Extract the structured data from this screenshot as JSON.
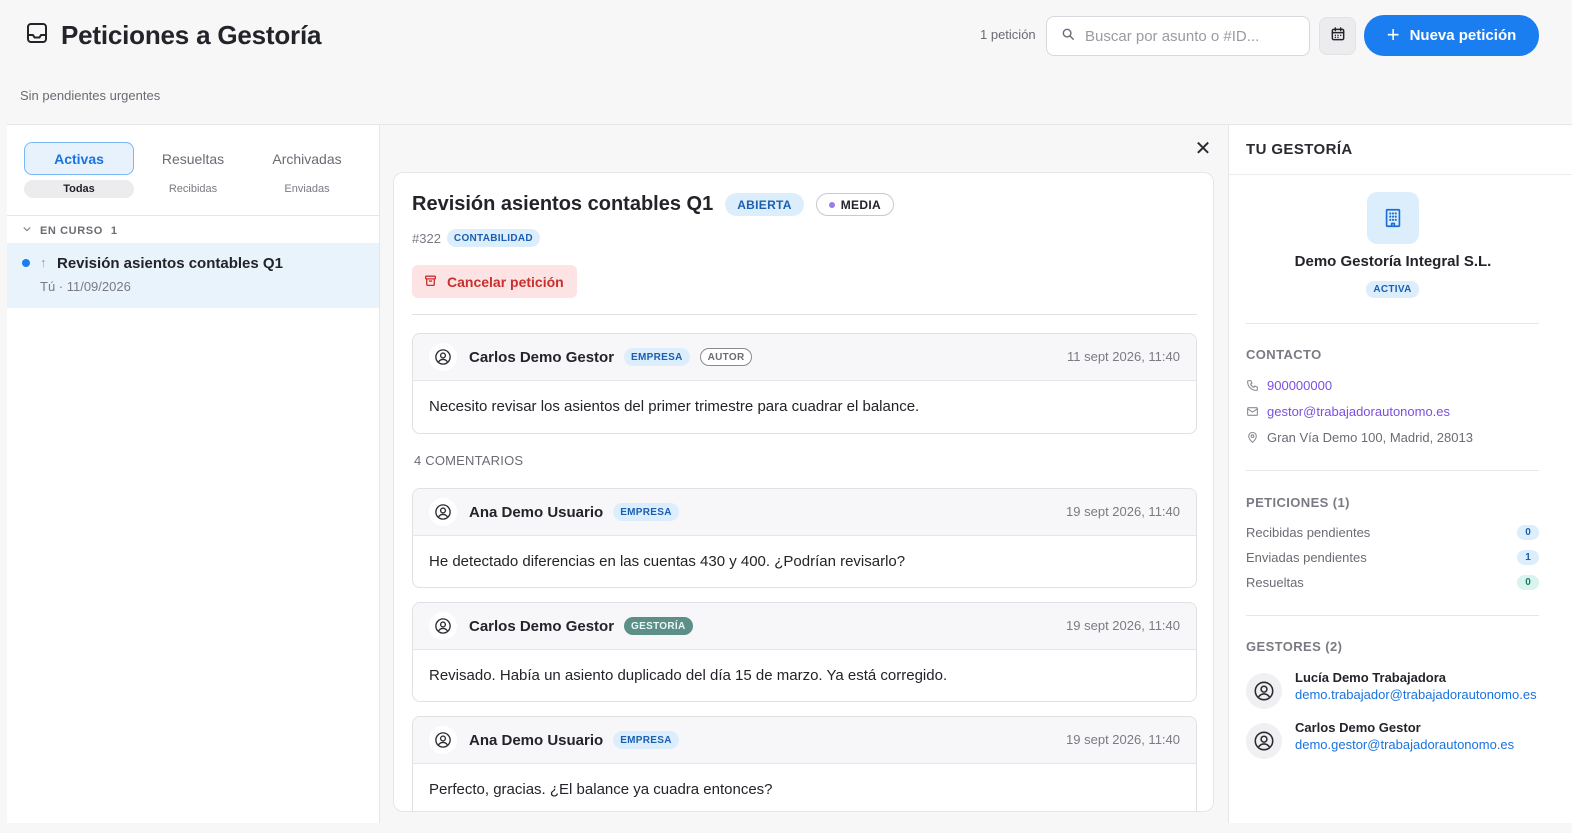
{
  "header": {
    "title": "Peticiones a Gestoría",
    "subtitle": "Sin pendientes urgentes",
    "count_label": "1 petición",
    "search_placeholder": "Buscar por asunto o #ID...",
    "new_button_label": "Nueva petición",
    "accent_color": "#1a7df0"
  },
  "left": {
    "tabs": [
      "Activas",
      "Resueltas",
      "Archivadas"
    ],
    "subtabs": [
      "Todas",
      "Recibidas",
      "Enviadas"
    ],
    "group_label": "EN CURSO",
    "group_count": "1",
    "items": [
      {
        "title": "Revisión asientos contables Q1",
        "meta": "Tú · 11/09/2026"
      }
    ]
  },
  "detail": {
    "title": "Revisión asientos contables Q1",
    "status": "ABIERTA",
    "priority": "MEDIA",
    "id": "#322",
    "category": "CONTABILIDAD",
    "cancel_label": "Cancelar petición",
    "original": {
      "author": "Carlos Demo Gestor",
      "tags": [
        "EMPRESA",
        "AUTOR"
      ],
      "date": "11 sept 2026, 11:40",
      "body": "Necesito revisar los asientos del primer trimestre para cuadrar el balance."
    },
    "comments_label": "4 COMENTARIOS",
    "comments": [
      {
        "author": "Ana Demo Usuario",
        "tag": "EMPRESA",
        "date": "19 sept 2026, 11:40",
        "body": "He detectado diferencias en las cuentas 430 y 400. ¿Podrían revisarlo?"
      },
      {
        "author": "Carlos Demo Gestor",
        "tag": "GESTORÍA",
        "date": "19 sept 2026, 11:40",
        "body": "Revisado. Había un asiento duplicado del día 15 de marzo. Ya está corregido."
      },
      {
        "author": "Ana Demo Usuario",
        "tag": "EMPRESA",
        "date": "19 sept 2026, 11:40",
        "body": "Perfecto, gracias. ¿El balance ya cuadra entonces?"
      }
    ]
  },
  "right": {
    "title": "TU GESTORÍA",
    "org_name": "Demo Gestoría Integral S.L.",
    "org_status": "ACTIVA",
    "contact_label": "CONTACTO",
    "phone": "900000000",
    "email": "gestor@trabajadorautonomo.es",
    "address": "Gran Vía Demo 100, Madrid, 28013",
    "requests_label": "PETICIONES (1)",
    "stats": [
      {
        "label": "Recibidas pendientes",
        "value": "0"
      },
      {
        "label": "Enviadas pendientes",
        "value": "1"
      },
      {
        "label": "Resueltas",
        "value": "0"
      }
    ],
    "managers_label": "GESTORES (2)",
    "managers": [
      {
        "name": "Lucía Demo Trabajadora",
        "email": "demo.trabajador@trabajadorautonomo.es"
      },
      {
        "name": "Carlos Demo Gestor",
        "email": "demo.gestor@trabajadorautonomo.es"
      }
    ]
  }
}
